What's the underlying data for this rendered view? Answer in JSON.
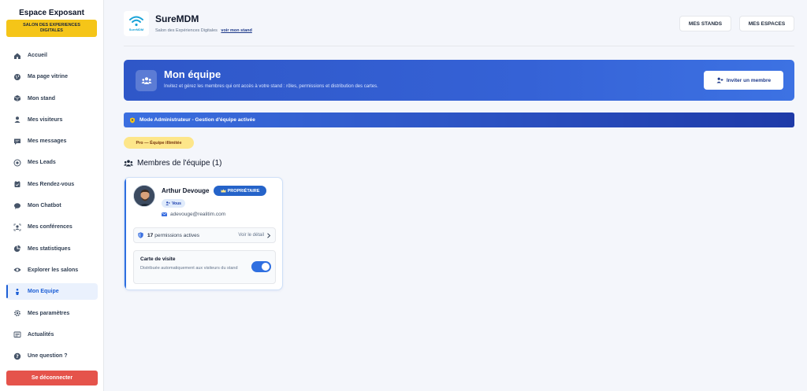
{
  "sidebar": {
    "title": "Espace Exposant",
    "badge": "SALON DES EXPERIENCES DIGITALES",
    "items": [
      {
        "label": "Accueil",
        "icon": "home-icon"
      },
      {
        "label": "Ma page vitrine",
        "icon": "globe-icon"
      },
      {
        "label": "Mon stand",
        "icon": "box-icon"
      },
      {
        "label": "Mes visiteurs",
        "icon": "user-icon"
      },
      {
        "label": "Mes messages",
        "icon": "message-icon"
      },
      {
        "label": "Mes Leads",
        "icon": "target-icon"
      },
      {
        "label": "Mes Rendez-vous",
        "icon": "calendar-icon"
      },
      {
        "label": "Mon Chatbot",
        "icon": "chat-icon"
      },
      {
        "label": "Mes conférences",
        "icon": "presenter-icon"
      },
      {
        "label": "Mes statistiques",
        "icon": "pie-chart-icon"
      },
      {
        "label": "Explorer les salons",
        "icon": "eye-icon"
      },
      {
        "label": "Mon Equipe",
        "icon": "team-icon",
        "active": true
      },
      {
        "label": "Mes paramètres",
        "icon": "gear-icon"
      },
      {
        "label": "Actualités",
        "icon": "news-icon"
      },
      {
        "label": "Une question ?",
        "icon": "question-icon"
      }
    ],
    "logout": "Se déconnecter"
  },
  "header": {
    "brand": "SureMDM",
    "logo_text": "SureMDM",
    "subtitle": "Salon des Expériences Digitales",
    "link": "voir mon stand",
    "btn_stands": "MES STANDS",
    "btn_espaces": "MES ESPACES"
  },
  "banner": {
    "title": "Mon équipe",
    "description": "Invitez et gérez les membres qui ont accès à votre stand : rôles, permissions et distribution des cartes.",
    "invite_label": "Inviter un membre"
  },
  "admin_bar": "Mode Administrateur - Gestion d'équipe activée",
  "plan_badge": "Pro — Équipe illimitée",
  "members_title": "Membres de l'équipe (1)",
  "member": {
    "name": "Arthur Devouge",
    "role_badge": "PROPRIÉTAIRE",
    "you_badge": "Vous",
    "email": "adevouge@realitim.com",
    "permissions_count": "17",
    "permissions_label": "permissions actives",
    "detail_label": "Voir le détail",
    "card_title": "Carte de visite",
    "card_desc": "Distribuée automatiquement aux visiteurs du stand",
    "card_enabled": true
  },
  "colors": {
    "accent": "#2f6fe0",
    "banner": "#3562d6",
    "badge_yellow": "#f5c518",
    "logout": "#e5534b"
  }
}
